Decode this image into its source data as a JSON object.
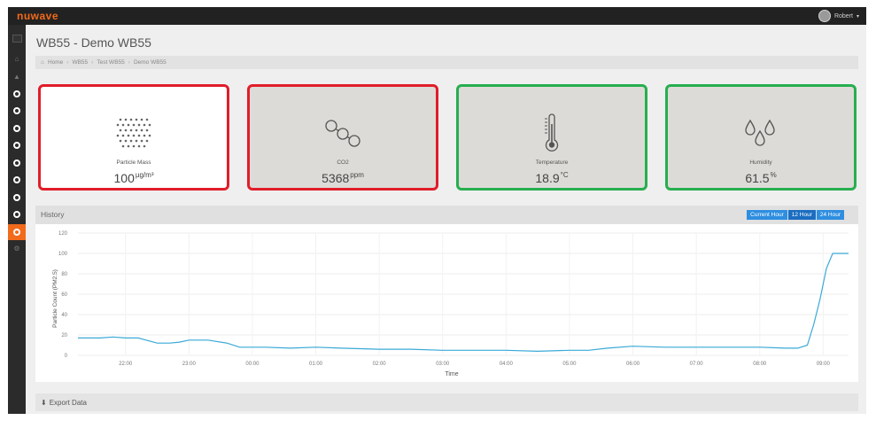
{
  "app": {
    "brand": "nuwave",
    "user_name": "Robert"
  },
  "page": {
    "title": "WB55 - Demo WB55"
  },
  "breadcrumb": [
    "Home",
    "WB55",
    "Test WB55",
    "Demo WB55"
  ],
  "cards": [
    {
      "label": "Particle Mass",
      "value": "100",
      "unit": "µg/m³",
      "status": "red",
      "icon": "particles-icon"
    },
    {
      "label": "CO2",
      "value": "5368",
      "unit": "ppm",
      "status": "red",
      "icon": "molecule-icon"
    },
    {
      "label": "Temperature",
      "value": "18.9",
      "unit": "°C",
      "status": "green",
      "icon": "thermometer-icon"
    },
    {
      "label": "Humidity",
      "value": "61.5",
      "unit": "%",
      "status": "green",
      "icon": "droplets-icon"
    }
  ],
  "history": {
    "title": "History",
    "ranges": [
      "Current Hour",
      "12 Hour",
      "24 Hour"
    ]
  },
  "export": {
    "label": "Export Data"
  },
  "colors": {
    "brand": "#f26a1b",
    "alarm": "#e11d2a",
    "ok": "#27ae4f",
    "series": "#3aa9d6",
    "button": "#2e8ee0"
  },
  "chart_data": {
    "type": "line",
    "xlabel": "Time",
    "ylabel": "Particle Count (PM2.5)",
    "ylim": [
      0,
      120
    ],
    "y_ticks": [
      0,
      20,
      40,
      60,
      80,
      100,
      120
    ],
    "x_ticks": [
      "22:00",
      "23:00",
      "00:00",
      "01:00",
      "02:00",
      "03:00",
      "04:00",
      "05:00",
      "06:00",
      "07:00",
      "08:00",
      "09:00"
    ],
    "x_range": [
      21.25,
      33.4
    ],
    "grid": true,
    "series": [
      {
        "x": [
          21.25,
          21.6,
          21.8,
          22.0,
          22.2,
          22.5,
          22.7,
          22.85,
          23.0,
          23.3,
          23.6,
          23.8,
          24.2,
          24.6,
          25.0,
          25.4,
          26.0,
          26.5,
          27.0,
          27.5,
          28.0,
          28.5,
          29.0,
          29.3,
          29.6,
          30.0,
          30.5,
          31.0,
          31.5,
          32.0,
          32.4,
          32.6,
          32.75,
          32.85,
          32.95,
          33.05,
          33.15,
          33.3,
          33.4
        ],
        "y": [
          17,
          17,
          18,
          17,
          17,
          12,
          12,
          13,
          15,
          15,
          12,
          8,
          8,
          7,
          8,
          7,
          6,
          6,
          5,
          5,
          5,
          4,
          5,
          5,
          7,
          9,
          8,
          8,
          8,
          8,
          7,
          7,
          10,
          30,
          55,
          85,
          100,
          100,
          100
        ]
      }
    ]
  }
}
